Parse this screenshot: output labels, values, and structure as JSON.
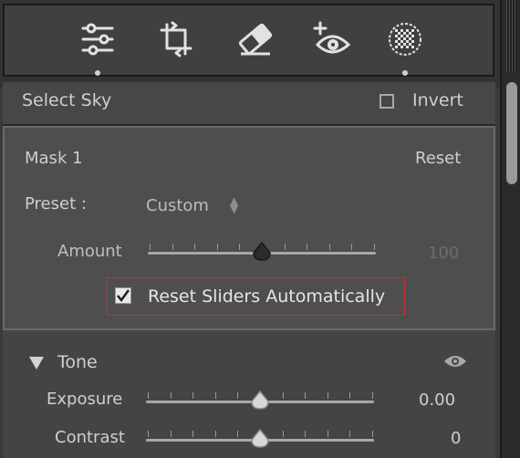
{
  "colors": {
    "panel_bg": "#4e4e4e",
    "highlight_border": "#c23232",
    "text": "#cfcfcf"
  },
  "toolbar": {
    "tools": [
      {
        "icon": "adjustment-sliders-icon",
        "active_dot": true
      },
      {
        "icon": "crop-rotate-icon",
        "active_dot": false
      },
      {
        "icon": "eraser-icon",
        "active_dot": false
      },
      {
        "icon": "red-eye-icon",
        "active_dot": false
      },
      {
        "icon": "masking-icon",
        "active_dot": true
      }
    ]
  },
  "sky_row": {
    "label": "Select Sky",
    "invert_label": "Invert",
    "invert_checked": false
  },
  "mask_panel": {
    "title": "Mask 1",
    "reset_label": "Reset",
    "preset_label": "Preset :",
    "preset_value": "Custom",
    "amount_label": "Amount",
    "amount_value": "100",
    "amount_level_fraction": 0.5,
    "reset_sliders_label": "Reset Sliders Automatically",
    "reset_sliders_checked": true
  },
  "tone": {
    "title": "Tone",
    "exposure_label": "Exposure",
    "exposure_value": "0.00",
    "exposure_level_fraction": 0.5,
    "contrast_label": "Contrast",
    "contrast_value": "0",
    "contrast_level_fraction": 0.5
  }
}
